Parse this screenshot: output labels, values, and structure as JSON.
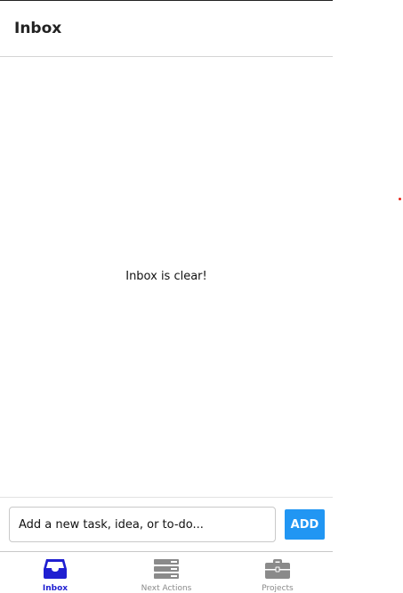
{
  "header": {
    "title": "Inbox"
  },
  "main": {
    "empty_message": "Inbox is clear!"
  },
  "composer": {
    "placeholder": "Add a new task, idea, or to-do...",
    "value": "",
    "add_label": "ADD"
  },
  "tabs": [
    {
      "label": "Inbox",
      "icon": "inbox-tray-icon",
      "active": true
    },
    {
      "label": "Next Actions",
      "icon": "server-stack-icon",
      "active": false
    },
    {
      "label": "Projects",
      "icon": "briefcase-icon",
      "active": false
    }
  ],
  "colors": {
    "accent": "#2196f3",
    "active_tab": "#1f1fd1",
    "inactive_tab": "#8a8a8a",
    "border": "#d4d4d4"
  }
}
